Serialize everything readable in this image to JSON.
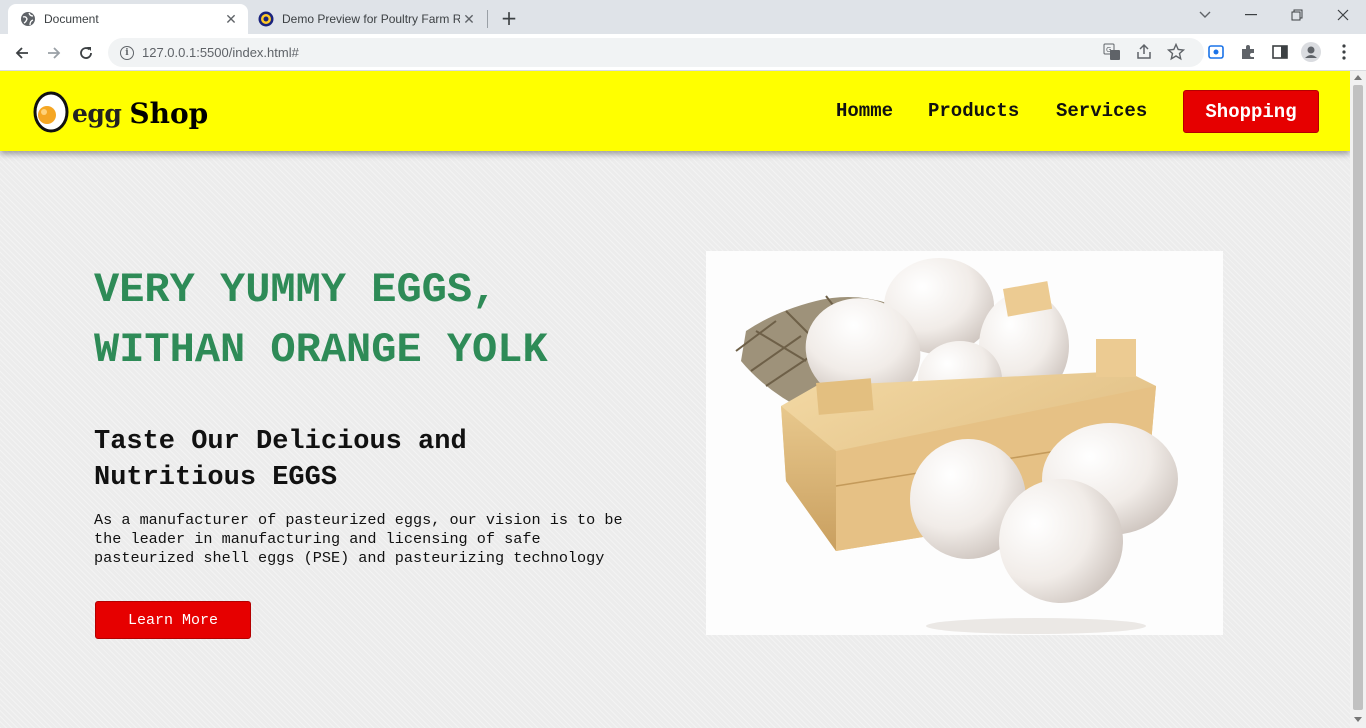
{
  "browser": {
    "tabs": [
      {
        "title": "Document",
        "active": true
      },
      {
        "title": "Demo Preview for Poultry Farm R",
        "active": false
      }
    ],
    "url": "127.0.0.1:5500/index.html#"
  },
  "site": {
    "logo": {
      "egg": "egg",
      "shop": "Shop"
    },
    "nav": {
      "home": "Homme",
      "products": "Products",
      "services": "Services",
      "shopping": "Shopping"
    },
    "hero": {
      "title_line1": "VERY YUMMY EGGS,",
      "title_line2": "WITHAN ORANGE YOLK",
      "subtitle_line1": "Taste Our Delicious and",
      "subtitle_line2": "Nutritious EGGS",
      "description_line1": "As a manufacturer of pasteurized eggs, our vision is to be",
      "description_line2": "the leader in manufacturing and licensing of safe",
      "description_line3": "pasteurized shell eggs (PSE) and pasteurizing technology",
      "cta": "Learn More"
    }
  },
  "colors": {
    "header_bg": "#ffff00",
    "button_red": "#e60000",
    "title_green": "#2e8b57"
  }
}
